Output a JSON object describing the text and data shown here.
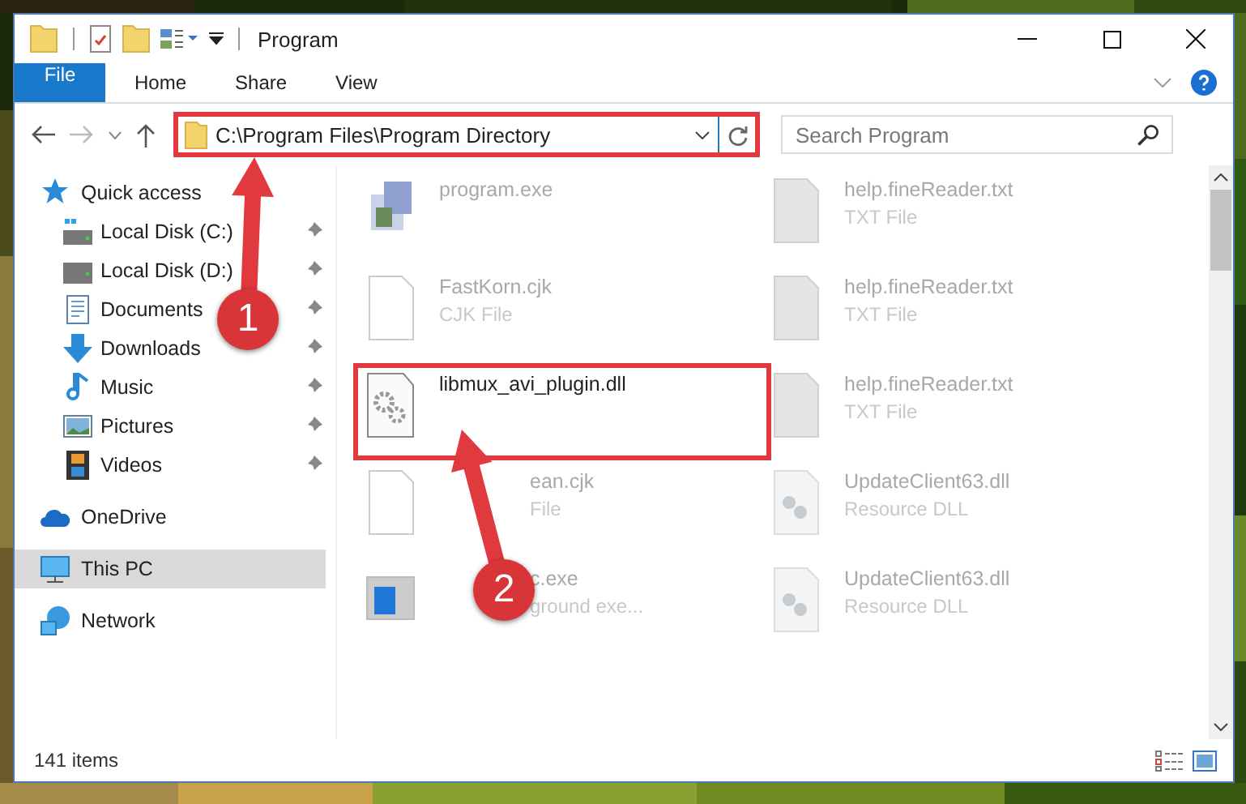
{
  "window": {
    "title": "Program"
  },
  "ribbon": {
    "tabs": [
      {
        "label": "File",
        "kind": "file"
      },
      {
        "label": "Home",
        "kind": "plain"
      },
      {
        "label": "Share",
        "kind": "plain"
      },
      {
        "label": "View",
        "kind": "plain"
      }
    ]
  },
  "address_bar": {
    "path": "C:\\Program Files\\Program Directory",
    "highlighted": true
  },
  "search": {
    "placeholder": "Search Program"
  },
  "sidebar": {
    "items": [
      {
        "label": "Quick access",
        "selected": false,
        "children": [
          {
            "label": "Local Disk (C:)",
            "pinned": true,
            "selected": false
          },
          {
            "label": "Local Disk (D:)",
            "pinned": true,
            "selected": false
          },
          {
            "label": "Documents",
            "pinned": true,
            "selected": false
          },
          {
            "label": "Downloads",
            "pinned": true,
            "selected": false
          },
          {
            "label": "Music",
            "pinned": true,
            "selected": false
          },
          {
            "label": "Pictures",
            "pinned": true,
            "selected": false
          },
          {
            "label": "Videos",
            "pinned": true,
            "selected": false
          }
        ]
      },
      {
        "label": "OneDrive",
        "selected": false
      },
      {
        "label": "This PC",
        "selected": true
      },
      {
        "label": "Network",
        "selected": false
      }
    ]
  },
  "files": [
    {
      "name": "program.exe",
      "kind": "exe",
      "faded": true,
      "highlighted": false,
      "covered_start": false
    },
    {
      "name": "help.fineReader.txt",
      "type": "TXT File",
      "kind": "txt",
      "faded": true,
      "highlighted": false,
      "covered_start": false
    },
    {
      "name": "FastKorn.cjk",
      "type": "CJK File",
      "kind": "blank",
      "faded": true,
      "highlighted": false,
      "covered_start": false
    },
    {
      "name": "help.fineReader.txt",
      "type": "TXT File",
      "kind": "txt",
      "faded": true,
      "highlighted": false,
      "covered_start": false
    },
    {
      "name": "libmux_avi_plugin.dll",
      "kind": "dll",
      "faded": false,
      "highlighted": true,
      "covered_start": false
    },
    {
      "name": "help.fineReader.txt",
      "type": "TXT File",
      "kind": "txt",
      "faded": true,
      "highlighted": false,
      "covered_start": false
    },
    {
      "name": "ean.cjk",
      "type": "File",
      "kind": "blank",
      "faded": true,
      "highlighted": false,
      "covered_start": true
    },
    {
      "name": "UpdateClient63.dll",
      "type": "Resource DLL",
      "kind": "resource",
      "faded": true,
      "highlighted": false,
      "covered_start": false
    },
    {
      "name": "c.exe",
      "type": "ground exe...",
      "kind": "app",
      "faded": true,
      "highlighted": false,
      "covered_start": true
    },
    {
      "name": "UpdateClient63.dll",
      "type": "Resource DLL",
      "kind": "resource",
      "faded": true,
      "highlighted": false,
      "covered_start": false
    }
  ],
  "status_bar": {
    "item_count": "141 items"
  },
  "callouts": [
    {
      "number": "1"
    },
    {
      "number": "2"
    }
  ]
}
